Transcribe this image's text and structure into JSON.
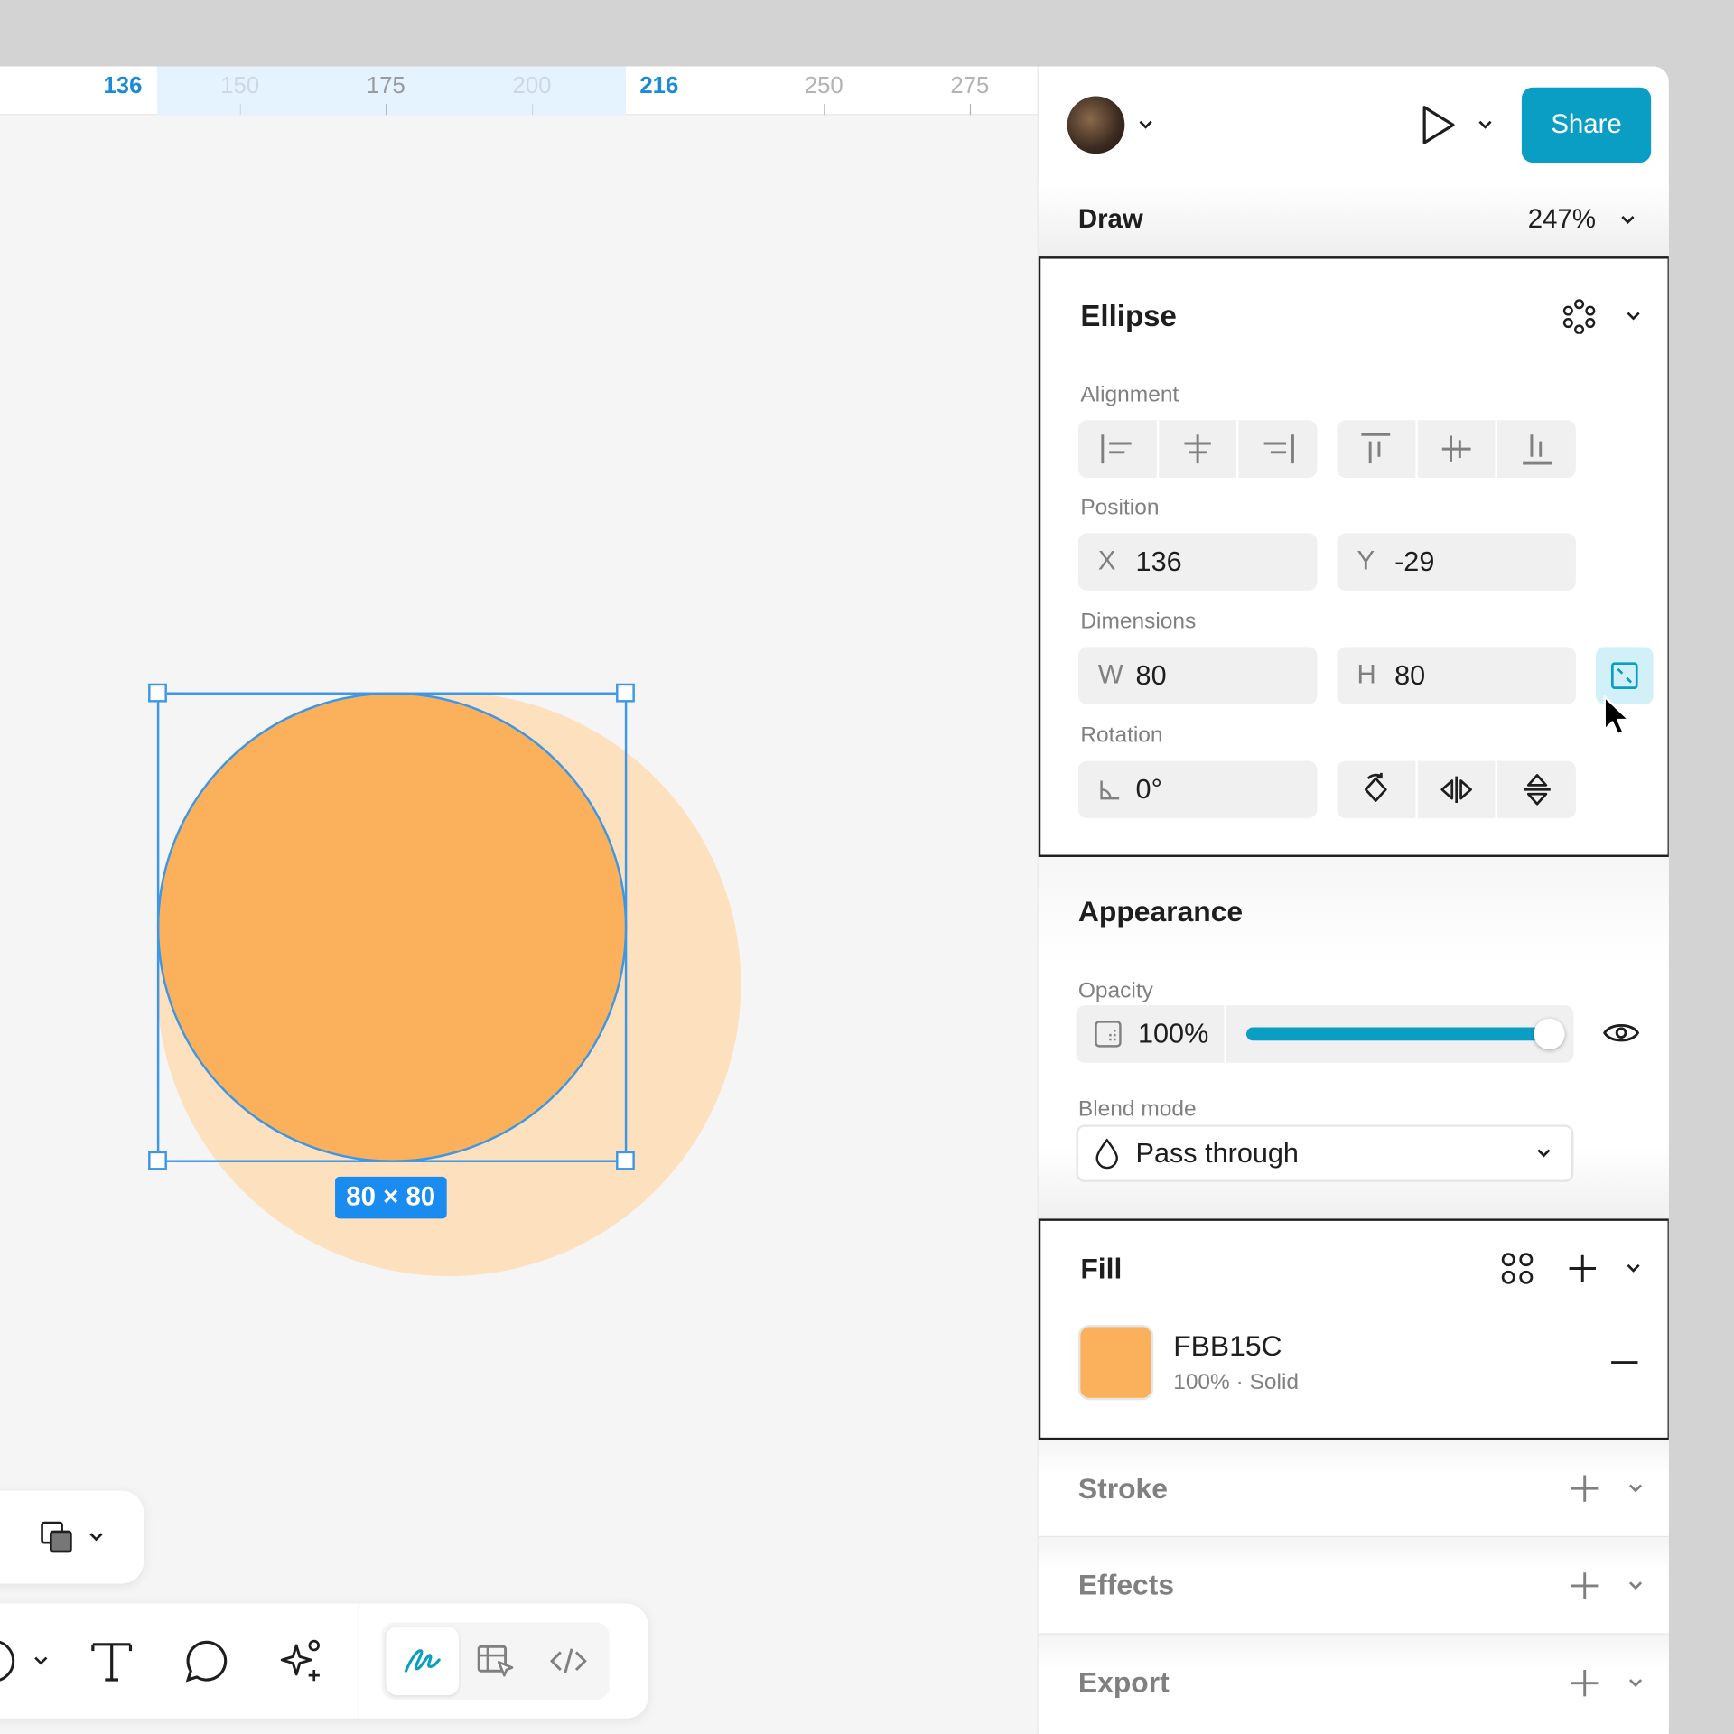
{
  "ruler": {
    "ticks": [
      "136",
      "150",
      "175",
      "200",
      "216",
      "250",
      "275"
    ]
  },
  "canvas": {
    "size_badge": "80 × 80"
  },
  "header": {
    "share_label": "Share",
    "mode_label": "Draw",
    "zoom": "247%"
  },
  "layer": {
    "title": "Ellipse"
  },
  "alignment": {
    "label": "Alignment"
  },
  "position": {
    "label": "Position",
    "x_prefix": "X",
    "x_value": "136",
    "y_prefix": "Y",
    "y_value": "-29"
  },
  "dimensions": {
    "label": "Dimensions",
    "w_prefix": "W",
    "w_value": "80",
    "h_prefix": "H",
    "h_value": "80"
  },
  "rotation": {
    "label": "Rotation",
    "value": "0°"
  },
  "appearance": {
    "title": "Appearance",
    "opacity_label": "Opacity",
    "opacity_value": "100%",
    "opacity_level": 1.0,
    "blend_label": "Blend mode",
    "blend_value": "Pass through"
  },
  "fill": {
    "title": "Fill",
    "hex": "FBB15C",
    "detail": "100% · Solid",
    "color": "#FBB15C"
  },
  "stroke": {
    "title": "Stroke"
  },
  "effects": {
    "title": "Effects"
  },
  "export": {
    "title": "Export"
  },
  "colors": {
    "accent": "#0A9EC4",
    "selection": "#3D97E6",
    "shape": "#FBB15C",
    "shape_shadow": "#FDE0BD"
  }
}
